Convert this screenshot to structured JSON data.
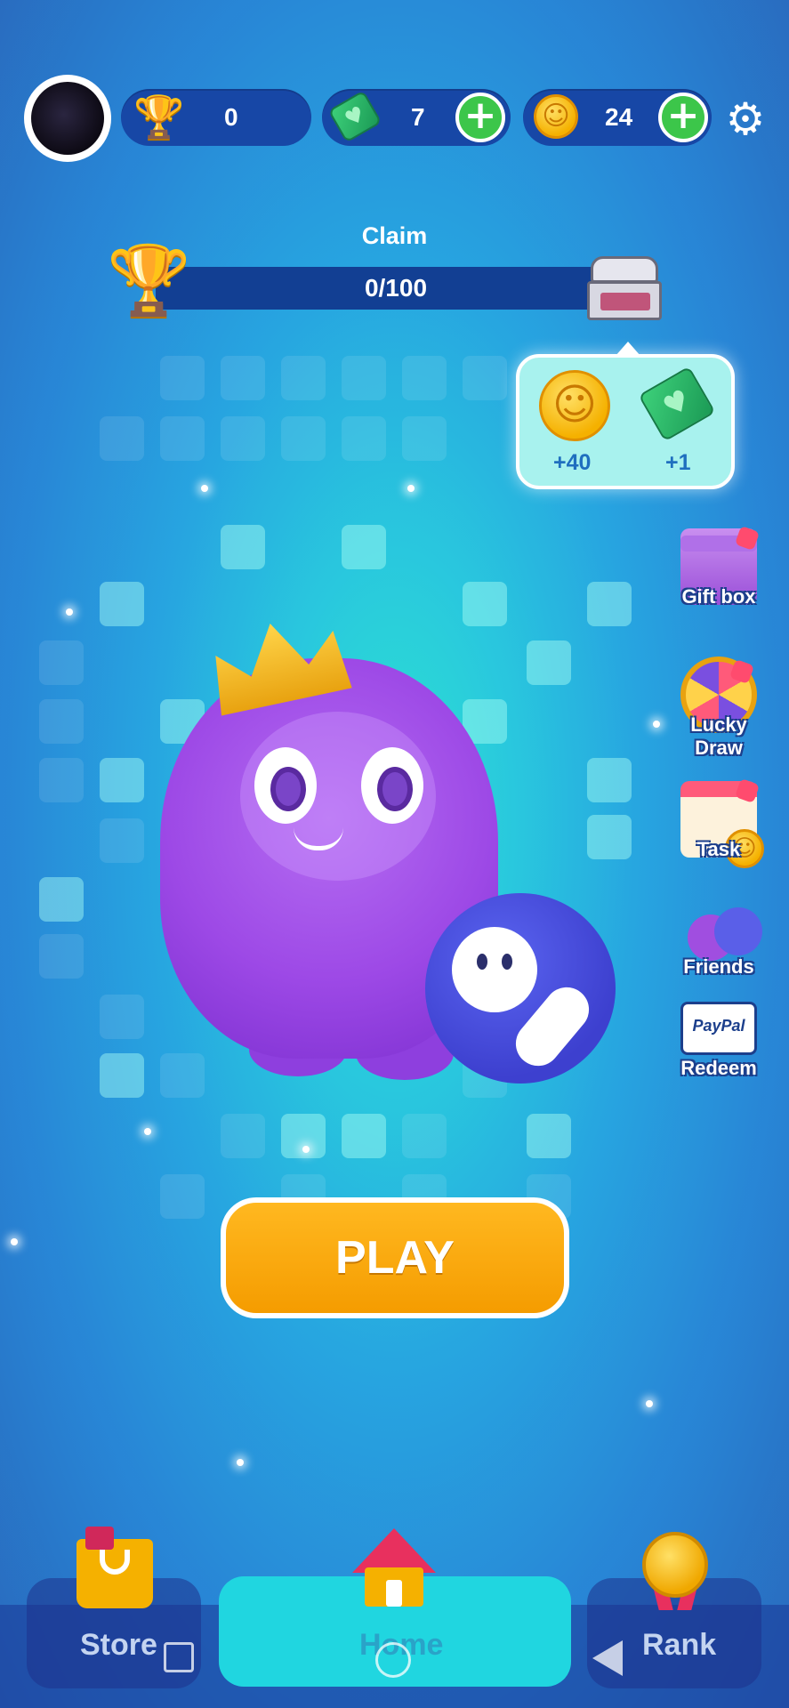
{
  "top_bar": {
    "trophies": "0",
    "tickets": "7",
    "coins": "24"
  },
  "progress": {
    "claim_label": "Claim",
    "text": "0/100",
    "fraction": 0
  },
  "reward_popup": {
    "coins": "+40",
    "tickets": "+1"
  },
  "side_menu": [
    {
      "label": "Gift box",
      "icon": "gift-box-icon"
    },
    {
      "label": "Lucky Draw",
      "icon": "lucky-wheel-icon"
    },
    {
      "label": "Task",
      "icon": "calendar-icon"
    },
    {
      "label": "Friends",
      "icon": "friends-icon"
    },
    {
      "label": "Redeem",
      "icon": "paypal-icon"
    }
  ],
  "paypal_text": "PayPal",
  "play_label": "PLAY",
  "bottom_nav": {
    "store": "Store",
    "home": "Home",
    "rank": "Rank"
  },
  "colors": {
    "accent_orange": "#f5a800",
    "nav_active": "#20d6e0",
    "pill_bg": "#1747a6",
    "plus_green": "#3cc64a"
  }
}
